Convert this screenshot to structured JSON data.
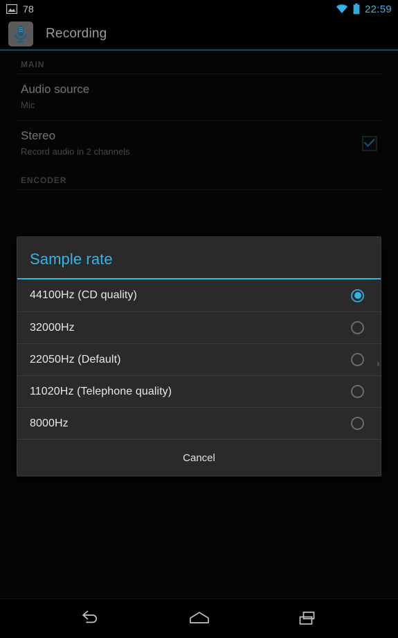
{
  "status_bar": {
    "screenshot_icon": "image-icon",
    "notification_count": "78",
    "wifi_icon": "wifi-icon",
    "battery_icon": "battery-icon",
    "clock": "22:59",
    "clock_color": "#44b2d6"
  },
  "action_bar": {
    "app_icon": "microphone-icon",
    "title": "Recording",
    "accent_color": "#12516c"
  },
  "settings": {
    "sections": [
      {
        "header": "MAIN",
        "rows": [
          {
            "title": "Audio source",
            "summary": "Mic",
            "control": "none"
          },
          {
            "title": "Stereo",
            "summary": "Record audio in 2 channels",
            "control": "checkbox",
            "checked": true
          }
        ]
      },
      {
        "header": "ENCODER",
        "rows": []
      }
    ]
  },
  "dialog": {
    "title": "Sample rate",
    "title_color": "#33b5e5",
    "options": [
      {
        "label": "44100Hz (CD quality)",
        "selected": true
      },
      {
        "label": "32000Hz",
        "selected": false
      },
      {
        "label": "22050Hz (Default)",
        "selected": false
      },
      {
        "label": "11020Hz (Telephone quality)",
        "selected": false
      },
      {
        "label": "8000Hz",
        "selected": false
      }
    ],
    "cancel_label": "Cancel"
  },
  "nav_bar": {
    "back_icon": "back-arrow-icon",
    "home_icon": "home-icon",
    "recents_icon": "recent-apps-icon"
  }
}
